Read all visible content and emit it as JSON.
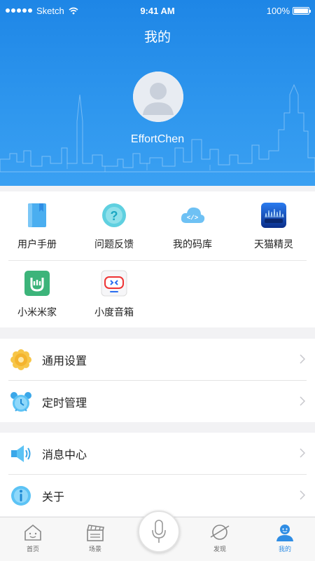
{
  "status_bar": {
    "carrier": "Sketch",
    "time": "9:41 AM",
    "battery": "100%"
  },
  "header": {
    "title": "我的",
    "username": "EffortChen"
  },
  "grid": {
    "items": [
      {
        "label": "用户手册",
        "icon": "book-icon"
      },
      {
        "label": "问题反馈",
        "icon": "question-icon"
      },
      {
        "label": "我的码库",
        "icon": "code-cloud-icon"
      },
      {
        "label": "天猫精灵",
        "icon": "tmall-genie-icon"
      },
      {
        "label": "小米米家",
        "icon": "mijia-icon"
      },
      {
        "label": "小度音箱",
        "icon": "xiaodu-icon"
      }
    ]
  },
  "menu_groups": [
    {
      "items": [
        {
          "label": "通用设置",
          "icon": "settings-icon"
        },
        {
          "label": "定时管理",
          "icon": "alarm-clock-icon"
        }
      ]
    },
    {
      "items": [
        {
          "label": "消息中心",
          "icon": "speaker-icon"
        },
        {
          "label": "关于",
          "icon": "info-icon"
        }
      ]
    }
  ],
  "tabbar": {
    "tabs": [
      {
        "label": "首页",
        "icon": "home-icon"
      },
      {
        "label": "场景",
        "icon": "clapperboard-icon"
      },
      {
        "label": "发现",
        "icon": "planet-icon"
      },
      {
        "label": "我的",
        "icon": "user-icon"
      }
    ],
    "active": "我的",
    "center_icon": "microphone-icon"
  },
  "colors": {
    "primary": "#1e86e6",
    "active_tab": "#2f8de4",
    "background": "#f2f2f4"
  }
}
